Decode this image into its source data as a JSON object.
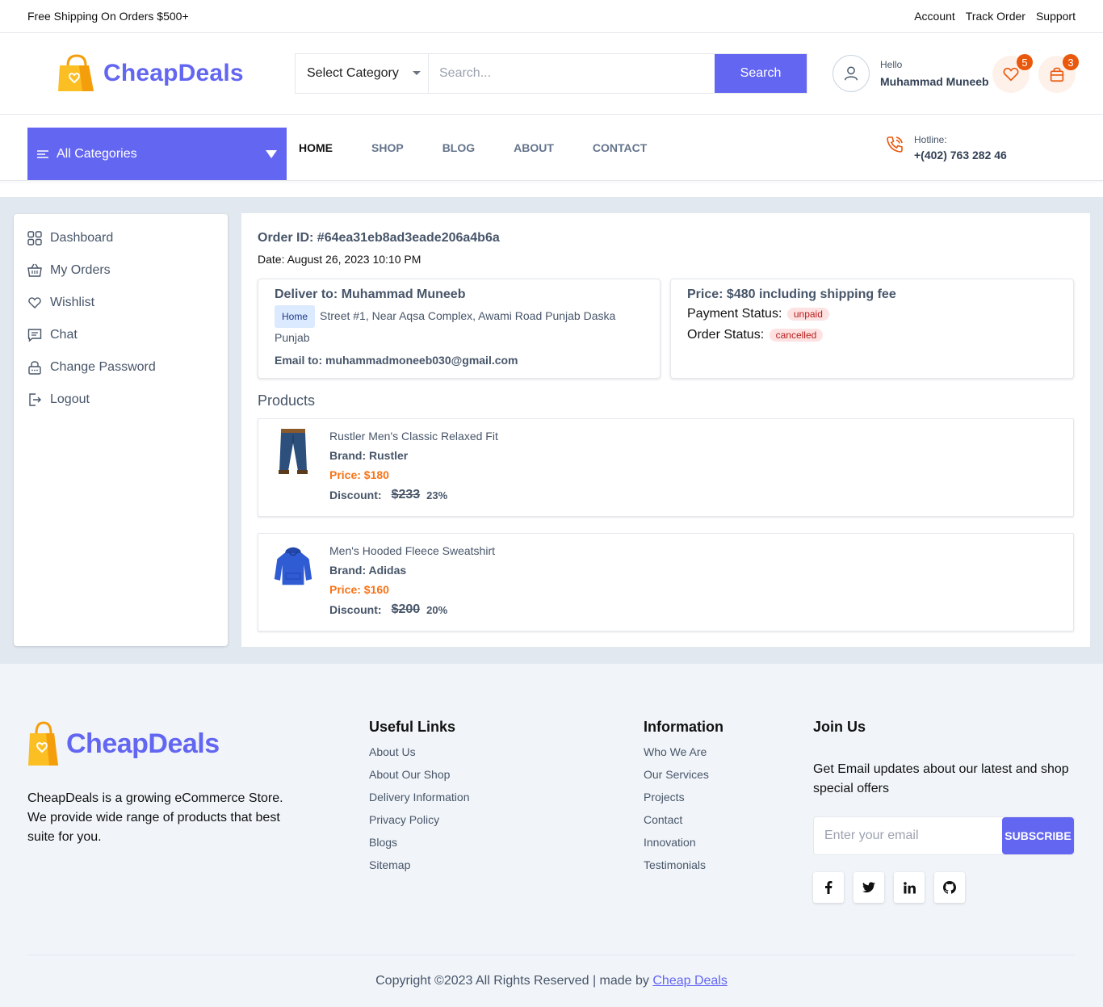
{
  "topbar": {
    "shipping": "Free Shipping On Orders $500+",
    "links": [
      "Account",
      "Track Order",
      "Support"
    ]
  },
  "header": {
    "logo": "CheapDeals",
    "category_select": "Select Category",
    "search_placeholder": "Search...",
    "search_button": "Search",
    "greeting": "Hello",
    "user_name": "Muhammad Muneeb",
    "wishlist_count": "5",
    "cart_count": "3"
  },
  "nav": {
    "all_categories": "All Categories",
    "items": [
      "HOME",
      "SHOP",
      "BLOG",
      "ABOUT",
      "CONTACT"
    ],
    "active": "HOME",
    "hotline_label": "Hotline:",
    "hotline_number": "+(402) 763 282 46"
  },
  "sidebar": {
    "items": [
      {
        "label": "Dashboard",
        "icon": "grid-icon"
      },
      {
        "label": "My Orders",
        "icon": "basket-icon"
      },
      {
        "label": "Wishlist",
        "icon": "heart-icon"
      },
      {
        "label": "Chat",
        "icon": "chat-icon"
      },
      {
        "label": "Change Password",
        "icon": "lock-icon"
      },
      {
        "label": "Logout",
        "icon": "logout-icon"
      }
    ]
  },
  "order": {
    "id": "Order ID: #64ea31eb8ad3eade206a4b6a",
    "date": "Date: August 26, 2023 10:10 PM",
    "deliver_to": "Deliver to: Muhammad Muneeb",
    "address_tag": "Home",
    "address": "Street #1, Near Aqsa Complex, Awami Road Punjab Daska Punjab",
    "email": "Email to: muhammadmoneeb030@gmail.com",
    "price": "Price: $480 including shipping fee",
    "payment_label": "Payment Status:",
    "payment_status": "unpaid",
    "order_label": "Order Status:",
    "order_status": "cancelled"
  },
  "products_title": "Products",
  "products": [
    {
      "name": "Rustler Men's Classic Relaxed Fit",
      "brand": "Brand: Rustler",
      "price": "Price: $180",
      "discount_label": "Discount:",
      "old_price": "$233",
      "percent": "23%",
      "image": "jeans"
    },
    {
      "name": "Men's Hooded Fleece Sweatshirt",
      "brand": "Brand: Adidas",
      "price": "Price: $160",
      "discount_label": "Discount:",
      "old_price": "$200",
      "percent": "20%",
      "image": "hoodie"
    }
  ],
  "footer": {
    "logo": "CheapDeals",
    "about": "CheapDeals is a growing eCommerce Store. We provide wide range of products that best suite for you.",
    "useful_title": "Useful Links",
    "useful_links": [
      "About Us",
      "About Our Shop",
      "Delivery Information",
      "Privacy Policy",
      "Blogs",
      "Sitemap"
    ],
    "info_title": "Information",
    "info_links": [
      "Who We Are",
      "Our Services",
      "Projects",
      "Contact",
      "Innovation",
      "Testimonials"
    ],
    "join_title": "Join Us",
    "join_text": "Get Email updates about our latest and shop special offers",
    "email_placeholder": "Enter your email",
    "subscribe": "SUBSCRIBE",
    "socials": [
      "f",
      "t",
      "in",
      "gh"
    ],
    "copyright": "Copyright ©2023 All Rights Reserved | made by",
    "copyright_link": "Cheap Deals"
  },
  "colors": {
    "accent": "#6366f1",
    "orange": "#ea580c",
    "price": "#f97316"
  }
}
